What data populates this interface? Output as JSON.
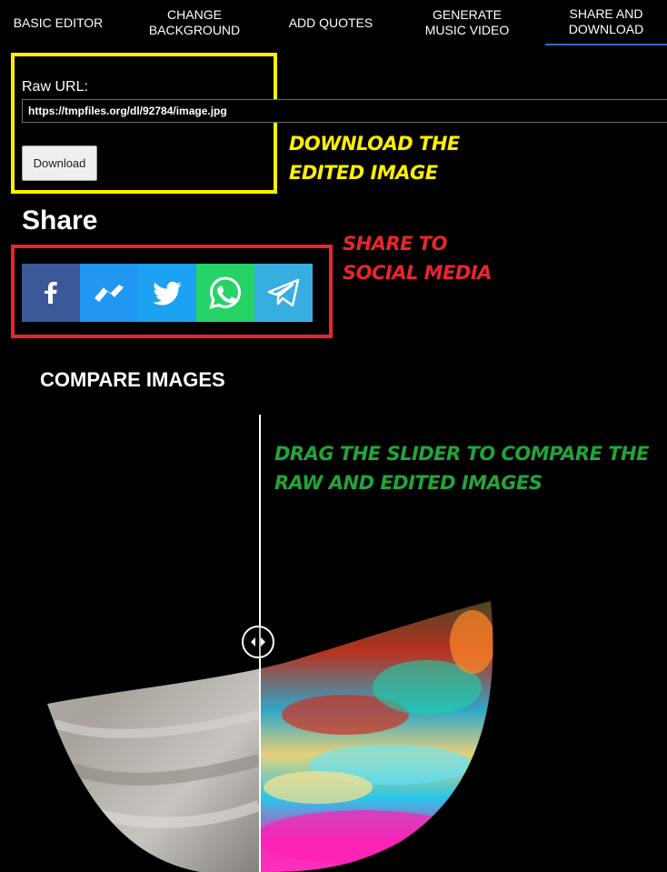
{
  "tabs": [
    {
      "label": "BASIC EDITOR",
      "active": false
    },
    {
      "label": "CHANGE\nBACKGROUND",
      "active": false
    },
    {
      "label": "ADD QUOTES",
      "active": false
    },
    {
      "label": "GENERATE\nMUSIC VIDEO",
      "active": false
    },
    {
      "label": "SHARE AND\nDOWNLOAD",
      "active": true
    }
  ],
  "download": {
    "raw_url_label": "Raw URL:",
    "raw_url_value": "https://tmpfiles.org/dl/92784/image.jpg",
    "download_button": "Download"
  },
  "share": {
    "title": "Share",
    "buttons": [
      {
        "icon": "facebook-icon",
        "color": "#3b5998"
      },
      {
        "icon": "messenger-icon",
        "color": "#2196f3"
      },
      {
        "icon": "twitter-icon",
        "color": "#1da1f2"
      },
      {
        "icon": "whatsapp-icon",
        "color": "#25d366"
      },
      {
        "icon": "telegram-icon",
        "color": "#37aee2"
      }
    ]
  },
  "compare": {
    "title": "COMPARE IMAGES"
  },
  "annotations": {
    "download_note": "DOWNLOAD THE\nEDITED IMAGE",
    "share_note": "SHARE TO\nSOCIAL MEDIA",
    "compare_note": "DRAG THE SLIDER TO COMPARE THE\nRAW AND EDITED IMAGES",
    "colors": {
      "download": "#ffee00",
      "share": "#e8262b",
      "compare": "#22a43a"
    }
  }
}
